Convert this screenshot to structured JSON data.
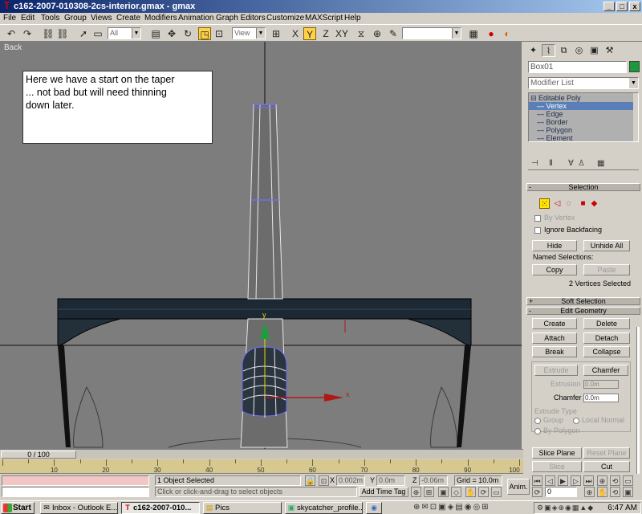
{
  "window": {
    "title": "c162-2007-010308-2cs-interior.gmax - gmax",
    "min": "_",
    "max": "□",
    "close": "x"
  },
  "menu": [
    "File",
    "Edit",
    "Tools",
    "Group",
    "Views",
    "Create",
    "Modifiers",
    "Animation",
    "Graph Editors",
    "Customize",
    "MAXScript",
    "Help"
  ],
  "toolbar": {
    "filter_value": "All",
    "refcoord_value": "View",
    "named_sel_value": ""
  },
  "viewport": {
    "label": "Back",
    "note_lines": [
      "Here we have a start on the taper",
      "... not bad but will need thinning",
      "down later."
    ],
    "gizmo_x": "x",
    "gizmo_y": "y"
  },
  "command_panel": {
    "object_name": "Box01",
    "object_color": "#1a9a3a",
    "modifier_list": "Modifier List",
    "stack": [
      {
        "label": "Editable Poly",
        "selected": false
      },
      {
        "label": "Vertex",
        "selected": true
      },
      {
        "label": "Edge",
        "selected": false
      },
      {
        "label": "Border",
        "selected": false
      },
      {
        "label": "Polygon",
        "selected": false
      },
      {
        "label": "Element",
        "selected": false
      }
    ],
    "selection": {
      "header": "Selection",
      "by_vertex": "By Vertex",
      "ignore_backfacing": "Ignore Backfacing",
      "hide": "Hide",
      "unhide_all": "Unhide All",
      "named_selections": "Named Selections:",
      "copy": "Copy",
      "paste": "Paste",
      "status": "2 Vertices Selected"
    },
    "soft_selection": {
      "header": "Soft Selection"
    },
    "edit_geometry": {
      "header": "Edit Geometry",
      "create": "Create",
      "delete": "Delete",
      "attach": "Attach",
      "detach": "Detach",
      "break": "Break",
      "collapse": "Collapse",
      "extrude": "Extrude",
      "chamfer": "Chamfer",
      "extrusion_label": "Extrusion",
      "extrusion_value": "0.0m",
      "chamfer_label": "Chamfer",
      "chamfer_value": "0.0m",
      "extrude_type": "Extrude Type",
      "group": "Group",
      "local_normal": "Local Normal",
      "by_polygon": "By Polygon",
      "slice_plane": "Slice Plane",
      "reset_plane": "Reset Plane",
      "slice": "Slice",
      "cut": "Cut"
    }
  },
  "timeline": {
    "slider_label": "0 / 100",
    "ticks": [
      10,
      20,
      30,
      40,
      50,
      60,
      70,
      80,
      90,
      100
    ]
  },
  "status": {
    "selected": "1 Object Selected",
    "prompt": "Click or click-and-drag to select objects",
    "x_label": "X",
    "x_value": "0.002m",
    "y_label": "Y",
    "y_value": "0.0m",
    "z_label": "Z",
    "z_value": "-0.06m",
    "grid": "Grid = 10.0m",
    "add_time_tag": "Add Time Tag",
    "anim": "Anim.",
    "frame_value": "0"
  },
  "taskbar": {
    "start": "Start",
    "tasks": [
      {
        "label": "Inbox - Outlook E...",
        "active": false,
        "icon": "✉"
      },
      {
        "label": "c162-2007-010...",
        "active": true,
        "icon": "T"
      },
      {
        "label": "Pics",
        "active": false,
        "icon": "▤"
      },
      {
        "label": "skycatcher_profile...",
        "active": false,
        "icon": "▣"
      },
      {
        "label": "",
        "active": false,
        "icon": "◉"
      }
    ],
    "clock": "6:47 AM"
  }
}
